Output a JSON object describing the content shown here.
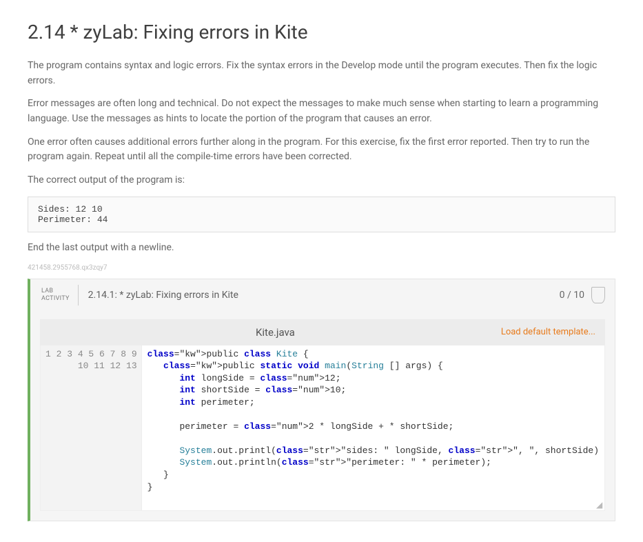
{
  "title": "2.14 * zyLab: Fixing errors in Kite",
  "paragraphs": {
    "p1": "The program contains syntax and logic errors. Fix the syntax errors in the Develop mode until the program executes. Then fix the logic errors.",
    "p2": "Error messages are often long and technical. Do not expect the messages to make much sense when starting to learn a programming language. Use the messages as hints to locate the portion of the program that causes an error.",
    "p3": "One error often causes additional errors further along in the program. For this exercise, fix the first error reported. Then try to run the program again. Repeat until all the compile-time errors have been corrected.",
    "p4": "The correct output of the program is:",
    "p5": "End the last output with a newline."
  },
  "expected_output": "Sides: 12 10\nPerimeter: 44",
  "watermark": "421458.2955768.qx3zqy7",
  "lab": {
    "label_line1": "LAB",
    "label_line2": "ACTIVITY",
    "title": "2.14.1: * zyLab: Fixing errors in Kite",
    "score": "0 / 10",
    "file_name": "Kite.java",
    "load_template": "Load default template..."
  },
  "code_lines": [
    "public class Kite {",
    "   public static void main(String [] args) {",
    "      int longSide = 12;",
    "      int shortSide = 10;",
    "      int perimeter;",
    "",
    "      perimeter = 2 * longSide + * shortSide;",
    "",
    "      System.out.printl(\"sides: \" longSide, \", \", shortSide)",
    "      System.out.println(\"perimeter: \" * perimeter);",
    "   }",
    "}",
    ""
  ]
}
